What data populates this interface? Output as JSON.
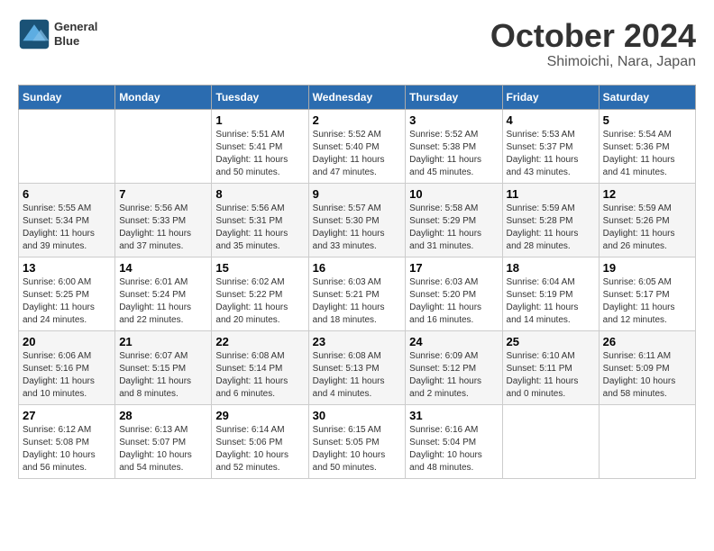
{
  "header": {
    "logo_line1": "General",
    "logo_line2": "Blue",
    "month": "October 2024",
    "location": "Shimoichi, Nara, Japan"
  },
  "weekdays": [
    "Sunday",
    "Monday",
    "Tuesday",
    "Wednesday",
    "Thursday",
    "Friday",
    "Saturday"
  ],
  "weeks": [
    [
      {
        "day": "",
        "info": ""
      },
      {
        "day": "",
        "info": ""
      },
      {
        "day": "1",
        "info": "Sunrise: 5:51 AM\nSunset: 5:41 PM\nDaylight: 11 hours and 50 minutes."
      },
      {
        "day": "2",
        "info": "Sunrise: 5:52 AM\nSunset: 5:40 PM\nDaylight: 11 hours and 47 minutes."
      },
      {
        "day": "3",
        "info": "Sunrise: 5:52 AM\nSunset: 5:38 PM\nDaylight: 11 hours and 45 minutes."
      },
      {
        "day": "4",
        "info": "Sunrise: 5:53 AM\nSunset: 5:37 PM\nDaylight: 11 hours and 43 minutes."
      },
      {
        "day": "5",
        "info": "Sunrise: 5:54 AM\nSunset: 5:36 PM\nDaylight: 11 hours and 41 minutes."
      }
    ],
    [
      {
        "day": "6",
        "info": "Sunrise: 5:55 AM\nSunset: 5:34 PM\nDaylight: 11 hours and 39 minutes."
      },
      {
        "day": "7",
        "info": "Sunrise: 5:56 AM\nSunset: 5:33 PM\nDaylight: 11 hours and 37 minutes."
      },
      {
        "day": "8",
        "info": "Sunrise: 5:56 AM\nSunset: 5:31 PM\nDaylight: 11 hours and 35 minutes."
      },
      {
        "day": "9",
        "info": "Sunrise: 5:57 AM\nSunset: 5:30 PM\nDaylight: 11 hours and 33 minutes."
      },
      {
        "day": "10",
        "info": "Sunrise: 5:58 AM\nSunset: 5:29 PM\nDaylight: 11 hours and 31 minutes."
      },
      {
        "day": "11",
        "info": "Sunrise: 5:59 AM\nSunset: 5:28 PM\nDaylight: 11 hours and 28 minutes."
      },
      {
        "day": "12",
        "info": "Sunrise: 5:59 AM\nSunset: 5:26 PM\nDaylight: 11 hours and 26 minutes."
      }
    ],
    [
      {
        "day": "13",
        "info": "Sunrise: 6:00 AM\nSunset: 5:25 PM\nDaylight: 11 hours and 24 minutes."
      },
      {
        "day": "14",
        "info": "Sunrise: 6:01 AM\nSunset: 5:24 PM\nDaylight: 11 hours and 22 minutes."
      },
      {
        "day": "15",
        "info": "Sunrise: 6:02 AM\nSunset: 5:22 PM\nDaylight: 11 hours and 20 minutes."
      },
      {
        "day": "16",
        "info": "Sunrise: 6:03 AM\nSunset: 5:21 PM\nDaylight: 11 hours and 18 minutes."
      },
      {
        "day": "17",
        "info": "Sunrise: 6:03 AM\nSunset: 5:20 PM\nDaylight: 11 hours and 16 minutes."
      },
      {
        "day": "18",
        "info": "Sunrise: 6:04 AM\nSunset: 5:19 PM\nDaylight: 11 hours and 14 minutes."
      },
      {
        "day": "19",
        "info": "Sunrise: 6:05 AM\nSunset: 5:17 PM\nDaylight: 11 hours and 12 minutes."
      }
    ],
    [
      {
        "day": "20",
        "info": "Sunrise: 6:06 AM\nSunset: 5:16 PM\nDaylight: 11 hours and 10 minutes."
      },
      {
        "day": "21",
        "info": "Sunrise: 6:07 AM\nSunset: 5:15 PM\nDaylight: 11 hours and 8 minutes."
      },
      {
        "day": "22",
        "info": "Sunrise: 6:08 AM\nSunset: 5:14 PM\nDaylight: 11 hours and 6 minutes."
      },
      {
        "day": "23",
        "info": "Sunrise: 6:08 AM\nSunset: 5:13 PM\nDaylight: 11 hours and 4 minutes."
      },
      {
        "day": "24",
        "info": "Sunrise: 6:09 AM\nSunset: 5:12 PM\nDaylight: 11 hours and 2 minutes."
      },
      {
        "day": "25",
        "info": "Sunrise: 6:10 AM\nSunset: 5:11 PM\nDaylight: 11 hours and 0 minutes."
      },
      {
        "day": "26",
        "info": "Sunrise: 6:11 AM\nSunset: 5:09 PM\nDaylight: 10 hours and 58 minutes."
      }
    ],
    [
      {
        "day": "27",
        "info": "Sunrise: 6:12 AM\nSunset: 5:08 PM\nDaylight: 10 hours and 56 minutes."
      },
      {
        "day": "28",
        "info": "Sunrise: 6:13 AM\nSunset: 5:07 PM\nDaylight: 10 hours and 54 minutes."
      },
      {
        "day": "29",
        "info": "Sunrise: 6:14 AM\nSunset: 5:06 PM\nDaylight: 10 hours and 52 minutes."
      },
      {
        "day": "30",
        "info": "Sunrise: 6:15 AM\nSunset: 5:05 PM\nDaylight: 10 hours and 50 minutes."
      },
      {
        "day": "31",
        "info": "Sunrise: 6:16 AM\nSunset: 5:04 PM\nDaylight: 10 hours and 48 minutes."
      },
      {
        "day": "",
        "info": ""
      },
      {
        "day": "",
        "info": ""
      }
    ]
  ]
}
